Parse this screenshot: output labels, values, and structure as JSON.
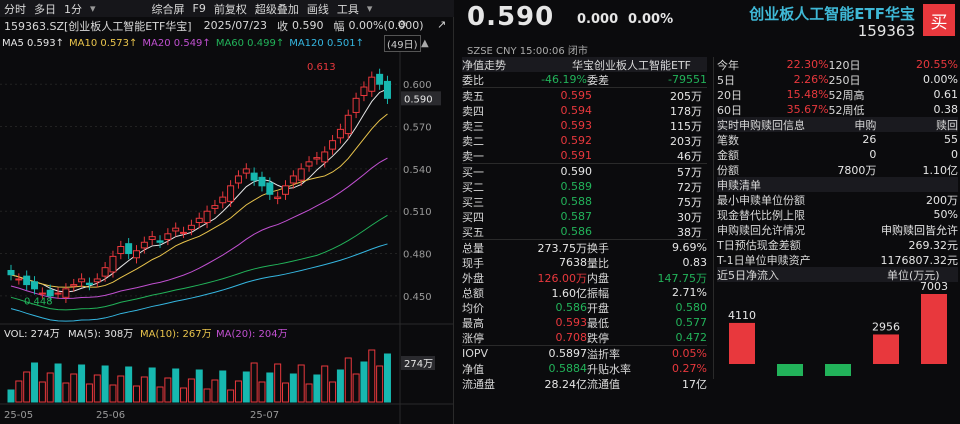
{
  "toolbar": {
    "items": [
      "分时",
      "多日",
      "1分",
      "综合屏",
      "F9",
      "前复权",
      "超级叠加",
      "画线",
      "工具"
    ]
  },
  "info": {
    "code": "159363.SZ[创业板人工智能ETF华宝]",
    "date": "2025/07/23",
    "close_label": "收",
    "close": "0.590",
    "range_label": "幅",
    "range": "0.00%(0.000)"
  },
  "ma": {
    "ma5": "MA5 0.593↑",
    "ma10": "MA10 0.573↑",
    "ma20": "MA20 0.549↑",
    "ma60": "MA60 0.499↑",
    "ma120": "MA120 0.501↑",
    "period": "(49日)"
  },
  "axis": {
    "y": [
      "0.600",
      "0.570",
      "0.540",
      "0.510",
      "0.480",
      "0.450"
    ],
    "current": "0.590",
    "high_label": "0.613",
    "low_label": "0.448",
    "x": [
      "25-05",
      "25-06",
      "25-07"
    ]
  },
  "vol": {
    "label": "VOL: 274万",
    "ma5": "MA(5): 308万",
    "ma10": "MA(10): 267万",
    "ma20": "MA(20): 204万",
    "current": "274万"
  },
  "header": {
    "price": "0.590",
    "change": "0.000",
    "pct": "0.00%",
    "name": "创业板人工智能ETF华宝",
    "code": "159363",
    "buy": "买",
    "sub": "SZSE  CNY  15:00:06 闭市"
  },
  "orderbook": {
    "title": "净值走势",
    "fund": "华宝创业板人工智能ETF",
    "wb": [
      "委比",
      "-46.19%",
      "委差",
      "-79551"
    ],
    "sells": [
      [
        "卖五",
        "0.595",
        "205万"
      ],
      [
        "卖四",
        "0.594",
        "178万"
      ],
      [
        "卖三",
        "0.593",
        "115万"
      ],
      [
        "卖二",
        "0.592",
        "203万"
      ],
      [
        "卖一",
        "0.591",
        "46万"
      ]
    ],
    "buys": [
      [
        "买一",
        "0.590",
        "57万"
      ],
      [
        "买二",
        "0.589",
        "72万"
      ],
      [
        "买三",
        "0.588",
        "75万"
      ],
      [
        "买四",
        "0.587",
        "30万"
      ],
      [
        "买五",
        "0.586",
        "38万"
      ]
    ],
    "stats": [
      [
        "总量",
        "273.75万",
        "换手",
        "9.69%"
      ],
      [
        "现手",
        "7638",
        "量比",
        "0.83"
      ],
      [
        "外盘",
        "126.00万",
        "内盘",
        "147.75万"
      ],
      [
        "总额",
        "1.60亿",
        "振幅",
        "2.71%"
      ],
      [
        "均价",
        "0.586",
        "开盘",
        "0.580"
      ],
      [
        "最高",
        "0.593",
        "最低",
        "0.577"
      ],
      [
        "涨停",
        "0.708",
        "跌停",
        "0.472"
      ]
    ],
    "iopv": [
      [
        "IOPV",
        "0.5897",
        "溢折率",
        "0.05%"
      ],
      [
        "净值",
        "0.5884",
        "升贴水率",
        "0.27%"
      ],
      [
        "流通盘",
        "28.24亿",
        "流通值",
        "17亿"
      ]
    ]
  },
  "perf": [
    [
      "今年",
      "22.30%",
      "120日",
      "20.55%"
    ],
    [
      "5日",
      "2.26%",
      "250日",
      "0.00%"
    ],
    [
      "20日",
      "15.48%",
      "52周高",
      "0.61"
    ],
    [
      "60日",
      "35.67%",
      "52周低",
      "0.38"
    ]
  ],
  "redeem": {
    "title": "实时申购赎回信息",
    "h1": "申购",
    "h2": "赎回",
    "rows": [
      [
        "笔数",
        "26",
        "55"
      ],
      [
        "金额",
        "0",
        "0"
      ],
      [
        "份额",
        "7800万",
        "1.10亿"
      ]
    ]
  },
  "list": {
    "title": "申赎清单",
    "rows": [
      [
        "最小申赎单位份额",
        "200万"
      ],
      [
        "现金替代比例上限",
        "50%"
      ],
      [
        "申购赎回允许情况",
        "申购赎回皆允许"
      ],
      [
        "T日预估现金差额",
        "269.32元"
      ],
      [
        "T-1日单位申赎资产",
        "1176807.32元"
      ]
    ]
  },
  "flow": {
    "title": "近5日净流入",
    "unit": "单位(万元)",
    "values": [
      4110,
      -1200,
      -1200,
      2956,
      7003
    ],
    "labels": [
      "4110",
      "",
      "",
      "2956",
      "7003"
    ]
  }
}
